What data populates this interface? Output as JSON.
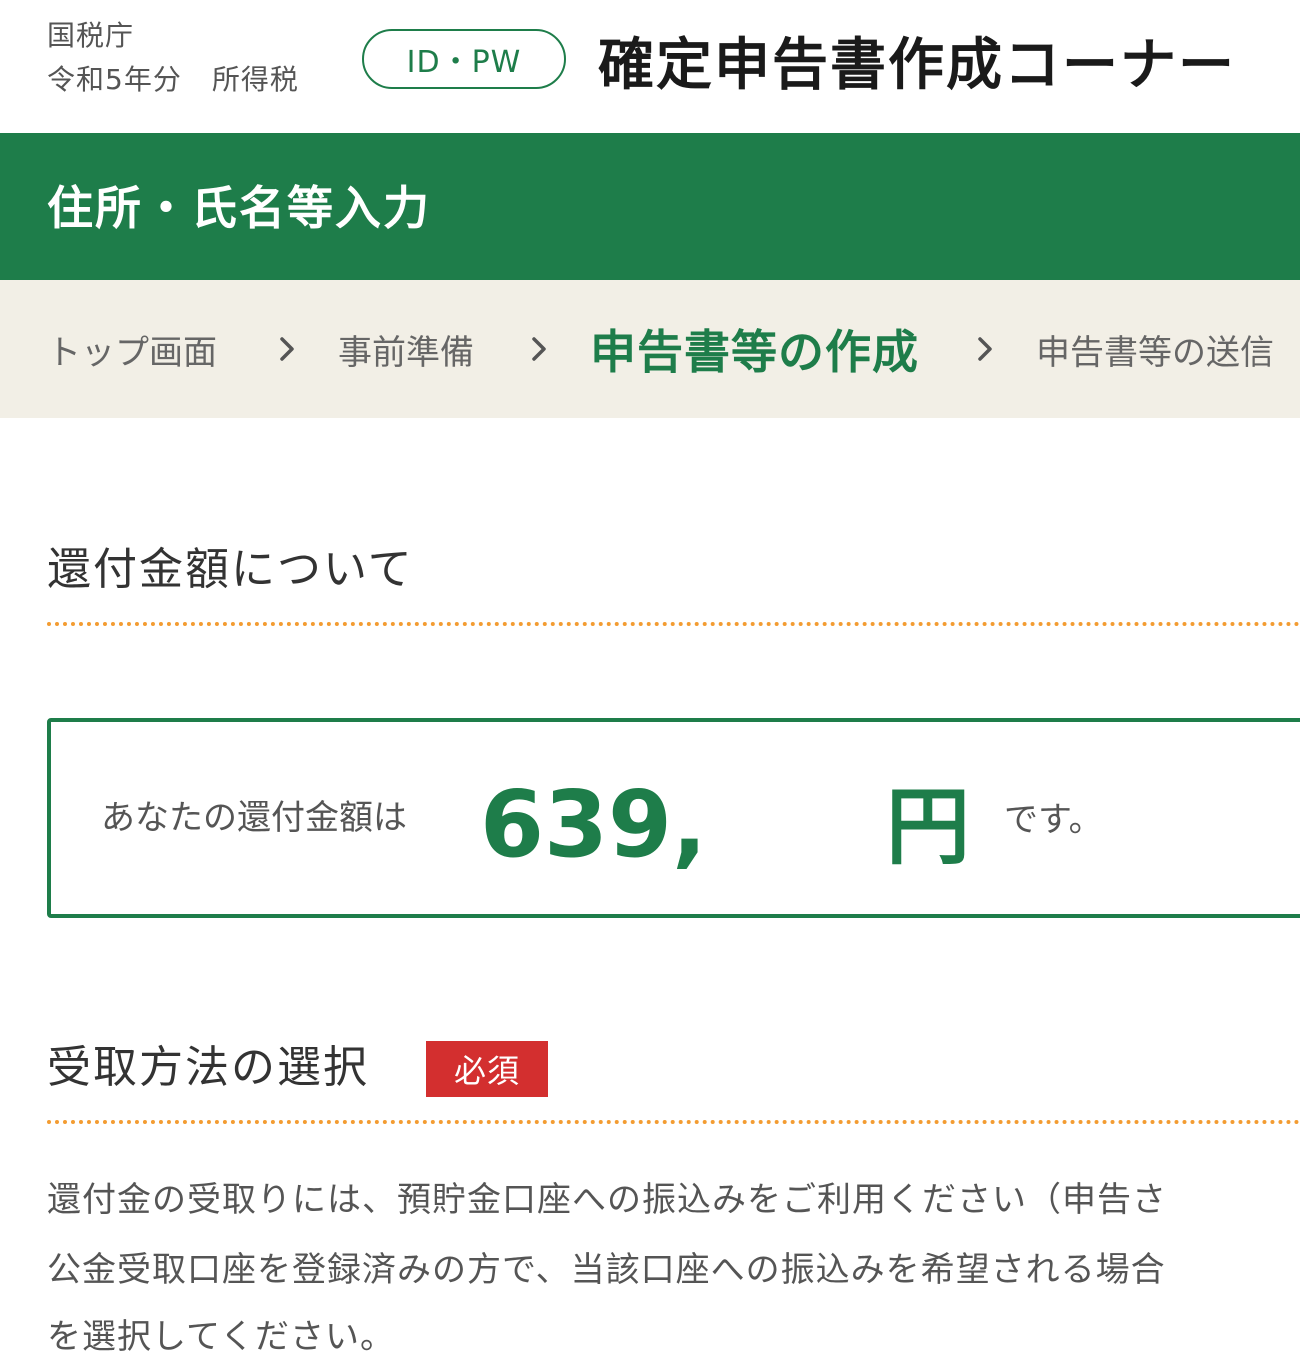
{
  "header": {
    "agency": "国税庁",
    "tax_year": "令和5年分",
    "tax_type": "所得税",
    "auth_badge": "ID・PW",
    "app_title": "確定申告書作成コーナー"
  },
  "page": {
    "title": "住所・氏名等入力"
  },
  "breadcrumb": {
    "items": [
      {
        "label": "トップ画面",
        "active": false
      },
      {
        "label": "事前準備",
        "active": false
      },
      {
        "label": "申告書等の作成",
        "active": true
      },
      {
        "label": "申告書等の送信",
        "active": false
      }
    ],
    "separator_icon": "chevron-right-icon"
  },
  "refund": {
    "heading": "還付金額について",
    "label": "あなたの還付金額は",
    "amount_visible": "639,",
    "unit": "円",
    "suffix": "です。"
  },
  "receipt": {
    "heading": "受取方法の選択",
    "required_label": "必須",
    "instructions": [
      "還付金の受取りには、預貯金口座への振込みをご利用ください（申告さ",
      "公金受取口座を登録済みの方で、当該口座への振込みを希望される場合",
      "を選択してください。"
    ]
  },
  "colors": {
    "brand_green": "#1e7d4a",
    "breadcrumb_bg": "#f2efe6",
    "dotted_rule": "#f39c32",
    "required_red": "#d32f2f"
  }
}
